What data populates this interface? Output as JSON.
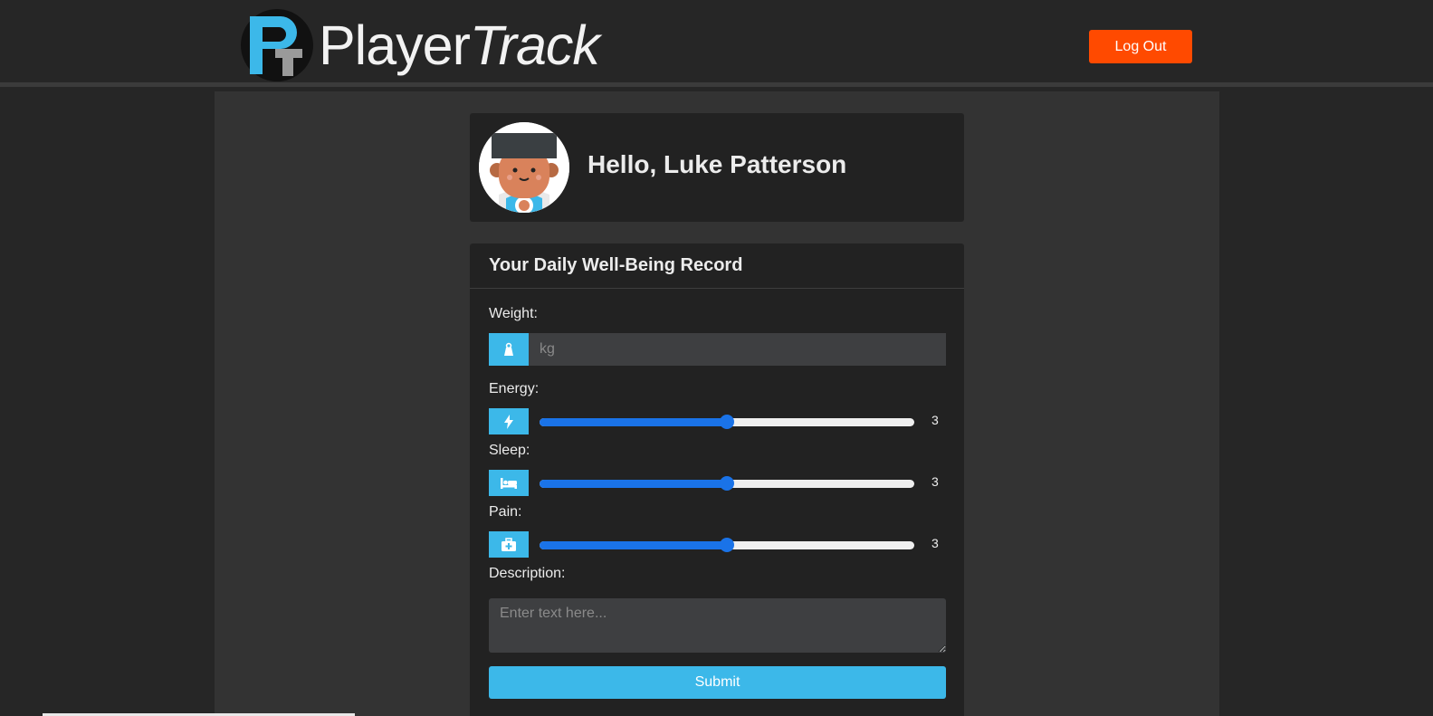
{
  "brand": {
    "name_plain": "Player",
    "name_italic": "Track",
    "logo_icon": "playertrack-logo-icon"
  },
  "header": {
    "logout_label": "Log Out"
  },
  "profile": {
    "greeting": "Hello, Luke Patterson",
    "avatar_icon": "player-avatar"
  },
  "form": {
    "title": "Your Daily Well-Being Record",
    "weight": {
      "label": "Weight:",
      "placeholder": "kg",
      "icon": "weight-icon"
    },
    "energy": {
      "label": "Energy:",
      "value": "3",
      "level": 0.5,
      "icon": "bolt-icon"
    },
    "sleep": {
      "label": "Sleep:",
      "value": "3",
      "level": 0.5,
      "icon": "bed-icon"
    },
    "pain": {
      "label": "Pain:",
      "value": "3",
      "level": 0.5,
      "icon": "medkit-icon"
    },
    "description": {
      "label": "Description:",
      "placeholder": "Enter text here..."
    },
    "submit_label": "Submit"
  },
  "colors": {
    "accent": "#3cb8e9",
    "logout": "#ff4a00",
    "slider": "#1a73e8"
  }
}
